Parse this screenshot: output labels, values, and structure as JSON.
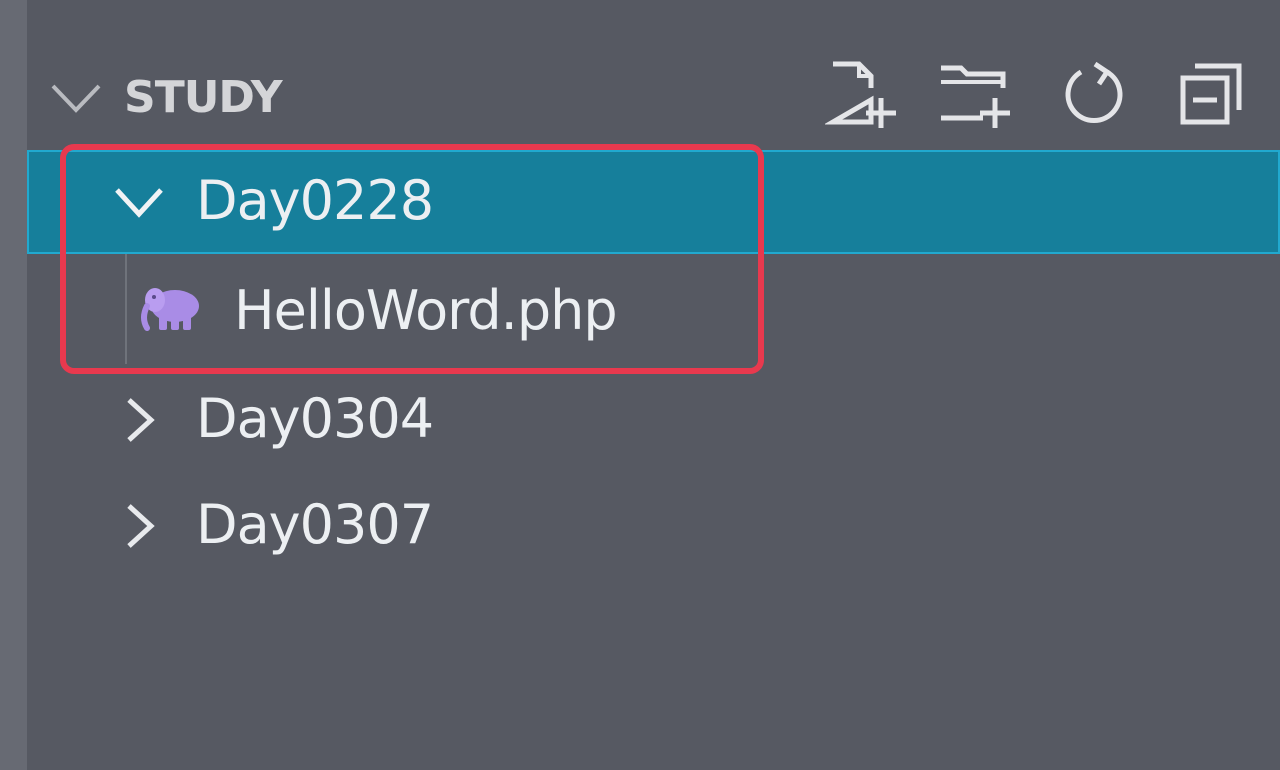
{
  "explorer": {
    "section_title": "STUDY",
    "actions": [
      {
        "icon": "new-file-icon"
      },
      {
        "icon": "new-folder-icon"
      },
      {
        "icon": "refresh-icon"
      },
      {
        "icon": "collapse-all-icon"
      }
    ],
    "tree": [
      {
        "label": "Day0228",
        "type": "folder",
        "expanded": true,
        "selected": true
      },
      {
        "label": "HelloWord.php",
        "type": "file",
        "icon": "php-elephant-icon",
        "icon_color": "#a98ce6"
      },
      {
        "label": "Day0304",
        "type": "folder",
        "expanded": false
      },
      {
        "label": "Day0307",
        "type": "folder",
        "expanded": false
      }
    ]
  },
  "colors": {
    "background": "#565962",
    "selection": "#167f9b",
    "selection_border": "#21a9cf",
    "highlight": "#e8394e",
    "text": "#eceff2"
  }
}
